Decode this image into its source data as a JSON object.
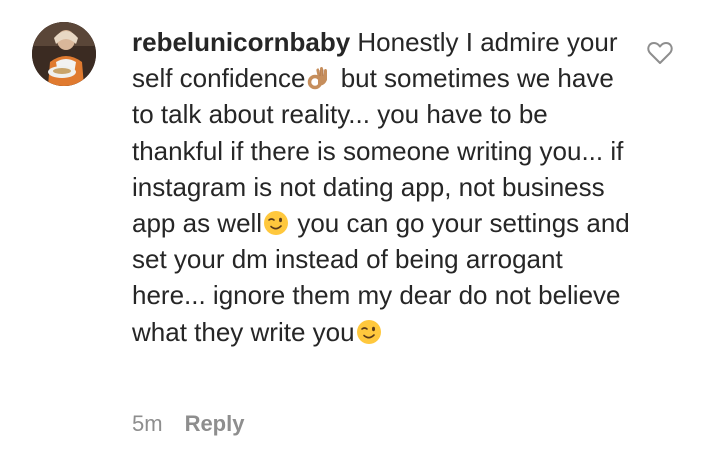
{
  "comment": {
    "username": "rebelunicornbaby",
    "text_parts": [
      "Honestly I admire your self confidence",
      "but sometimes we have to talk about reality... you have to be thankful if there is someone writing you... if instagram is not dating app, not business app as well",
      "you can go your settings and set your dm instead of being arrogant here... ignore them my dear do not believe what they write you"
    ],
    "emojis": [
      "ok-hand-emoji",
      "winking-face-emoji",
      "winking-face-emoji"
    ],
    "timestamp": "5m",
    "reply_label": "Reply"
  },
  "icons": {
    "like": "heart-outline-icon",
    "avatar": "profile-avatar"
  },
  "colors": {
    "text": "#262626",
    "meta": "#8e8e8e",
    "heart_outline": "#8e8e8e",
    "emoji_yellow": "#ffc83d",
    "ok_hand_skin": "#c68e5c"
  }
}
